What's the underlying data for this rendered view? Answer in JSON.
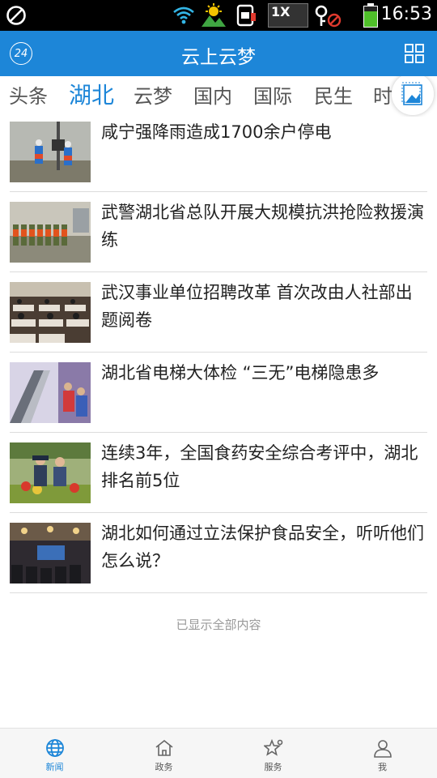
{
  "status_bar": {
    "time": "16:53",
    "notification_badge": "1X",
    "icons": [
      "blocked-icon",
      "wifi-icon",
      "weather-icon",
      "sim-icon",
      "notification-icon",
      "key-blocked-icon",
      "battery-icon"
    ]
  },
  "header": {
    "title": "云上云梦",
    "badge_text": "24"
  },
  "tabs": [
    {
      "label": "头条",
      "active": false
    },
    {
      "label": "湖北",
      "active": true
    },
    {
      "label": "云梦",
      "active": false
    },
    {
      "label": "国内",
      "active": false
    },
    {
      "label": "国际",
      "active": false
    },
    {
      "label": "民生",
      "active": false
    },
    {
      "label": "时",
      "active": false
    }
  ],
  "news": [
    {
      "title": "咸宁强降雨造成1700余户停电"
    },
    {
      "title": "武警湖北省总队开展大规模抗洪抢险救援演练"
    },
    {
      "title": "武汉事业单位招聘改革 首次改由人社部出题阅卷"
    },
    {
      "title": "湖北省电梯大体检 “三无”电梯隐患多"
    },
    {
      "title": "连续3年，全国食药安全综合考评中，湖北排名前5位"
    },
    {
      "title": "湖北如何通过立法保护食品安全，听听他们怎么说？"
    }
  ],
  "end_note": "已显示全部内容",
  "bottom_nav": [
    {
      "label": "新闻",
      "icon": "globe-icon",
      "active": true
    },
    {
      "label": "政务",
      "icon": "house-icon",
      "active": false
    },
    {
      "label": "服务",
      "icon": "star-service-icon",
      "active": false
    },
    {
      "label": "我",
      "icon": "person-icon",
      "active": false
    }
  ],
  "colors": {
    "accent": "#1d86d8",
    "header_bg": "#1d86d8",
    "status_bar_bg": "#000000"
  }
}
